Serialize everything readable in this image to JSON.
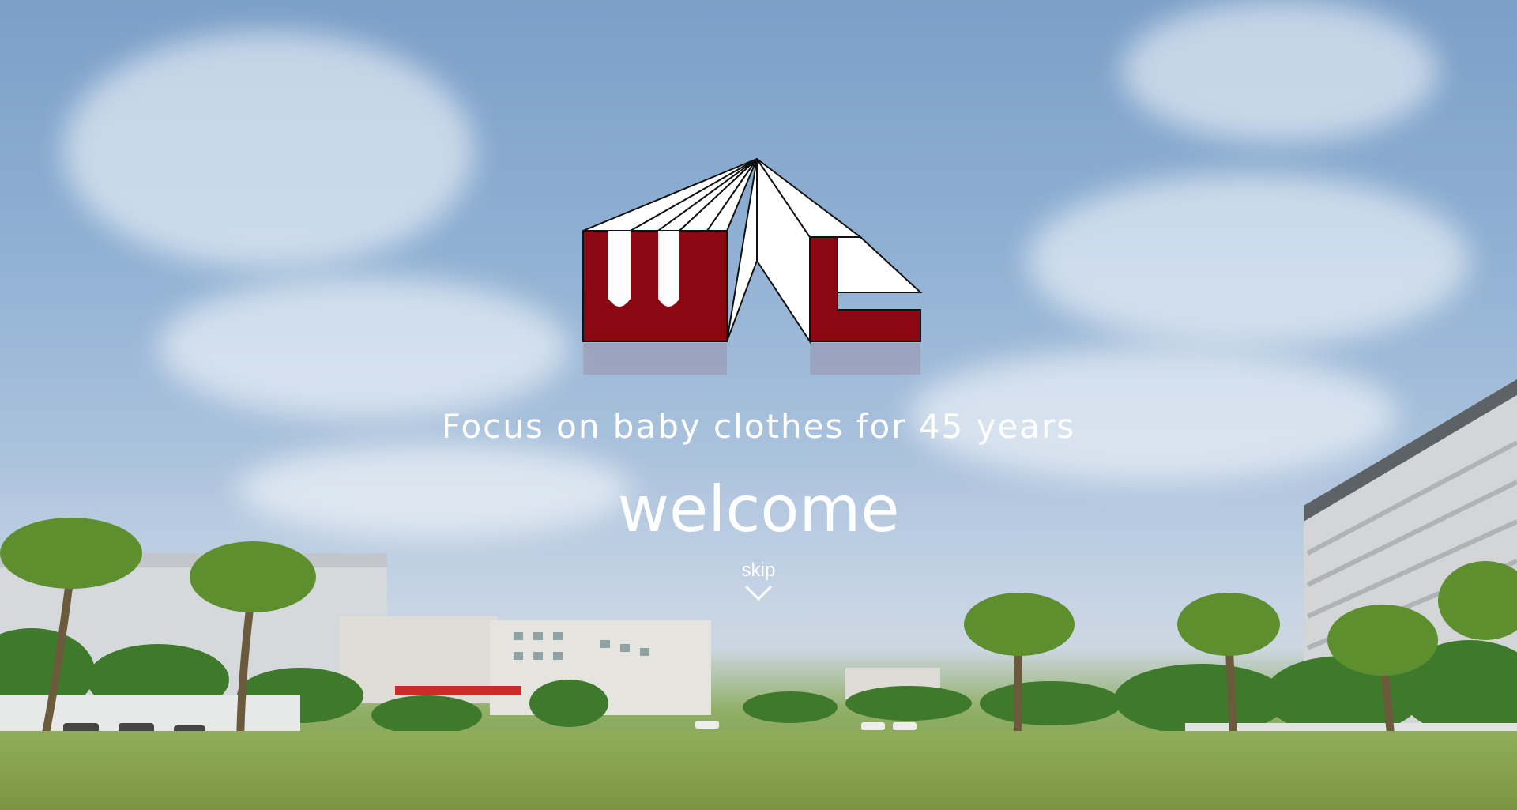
{
  "hero": {
    "tagline": "Focus on baby clothes for 45 years",
    "welcome": "welcome",
    "skip_label": "skip"
  },
  "logo": {
    "text": "WL",
    "colors": {
      "primary": "#8b0712",
      "white": "#ffffff",
      "outline": "#111111"
    }
  },
  "icons": {
    "skip": "chevron-down-icon"
  }
}
